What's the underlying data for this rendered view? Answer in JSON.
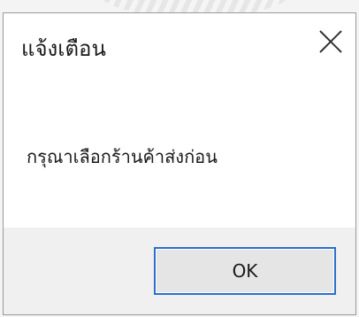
{
  "dialog": {
    "title": "แจ้งเตือน",
    "close_icon": "close-icon",
    "message": "กรุณาเลือกร้านค้าส่งก่อน",
    "ok_label": "OK"
  },
  "colors": {
    "focus_border": "#2b6fcf",
    "footer_bg": "#f0f0f0",
    "button_bg": "#e5e5e5"
  }
}
